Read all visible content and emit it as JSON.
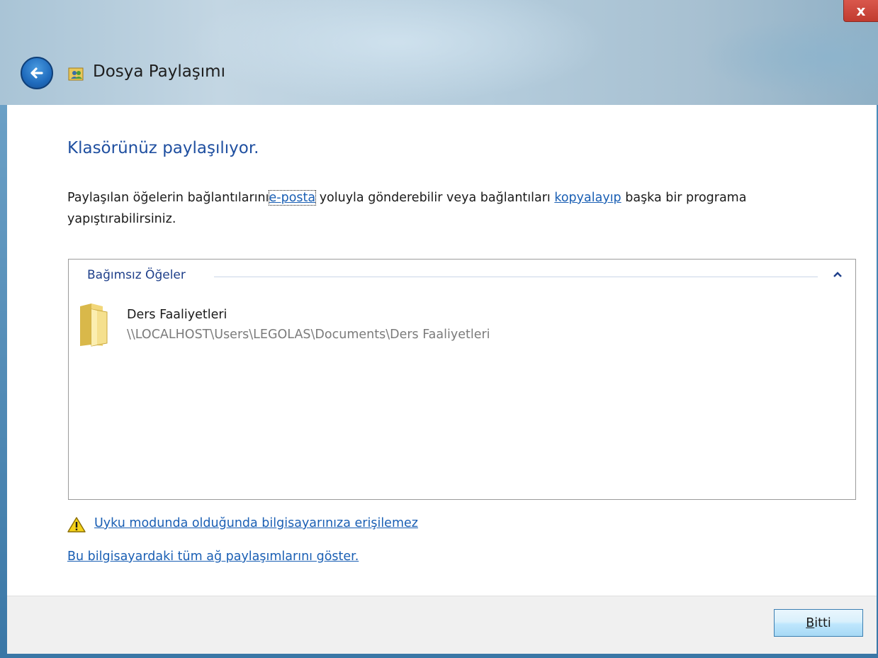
{
  "window": {
    "title": "Dosya Paylaşımı",
    "close_label": "x"
  },
  "main": {
    "heading": "Klasörünüz paylaşılıyor.",
    "description": {
      "part1": "Paylaşılan öğelerin bağlantılarını",
      "email_link": "e-posta",
      "part2": " yoluyla gönderebilir veya bağlantıları ",
      "copy_link": "kopyalayıp",
      "part3": " başka bir programa yapıştırabilirsiniz."
    },
    "list": {
      "group_header": "Bağımsız Öğeler",
      "items": [
        {
          "name": "Ders Faaliyetleri",
          "path": "\\\\LOCALHOST\\Users\\LEGOLAS\\Documents\\Ders Faaliyetleri"
        }
      ]
    },
    "sleep_warning_link": "Uyku modunda olduğunda bilgisayarınıza erişilemez",
    "show_shares_link": "Bu bilgisayardaki tüm ağ paylaşımlarını göster."
  },
  "footer": {
    "finish_button": {
      "accel": "B",
      "rest": "itti"
    }
  },
  "colors": {
    "heading": "#1f4fa0",
    "link": "#1a5fb4",
    "close_button": "#c13b2f",
    "back_button": "#1f6bbd"
  }
}
